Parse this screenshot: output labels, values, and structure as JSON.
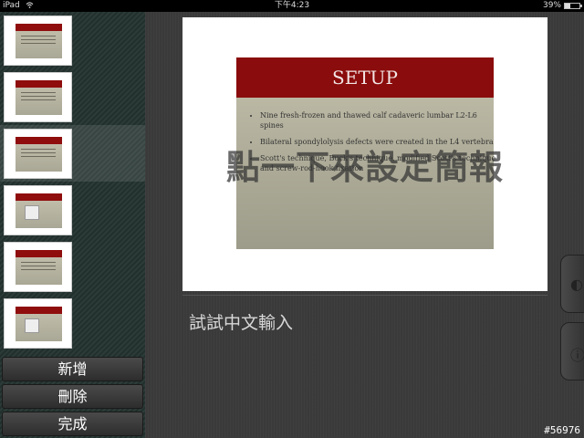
{
  "status_bar": {
    "device": "iPad",
    "time": "下午4:23",
    "battery_percent": "39%",
    "battery_level": 0.39
  },
  "sidebar": {
    "slides": [
      {
        "index": 1,
        "title": "OBJECTIVE"
      },
      {
        "index": 2,
        "title": ""
      },
      {
        "index": 3,
        "title": "SETUP",
        "selected": true
      },
      {
        "index": 4,
        "title": ""
      },
      {
        "index": 5,
        "title": ""
      },
      {
        "index": 6,
        "title": ""
      }
    ],
    "buttons": {
      "add": "新增",
      "delete": "刪除",
      "done": "完成"
    }
  },
  "slide": {
    "title": "SETUP",
    "bullets": [
      "Nine fresh-frozen and thawed calf cadaveric lumbar L2-L6 spines",
      "Bilateral spondylolysis defects were created in the L4 vertebra",
      "Scott's technique, Buck's technique, modified Scott's technique and screw-rod-hook fixation"
    ],
    "overlay_hint": "點一下來設定簡報"
  },
  "notes": {
    "text": "試試中文輸入"
  },
  "watermark": "#56976",
  "colors": {
    "slide_title_bar": "#8b0c0c",
    "sidebar_bg": "#243330",
    "main_bg": "#3a3a3a"
  }
}
